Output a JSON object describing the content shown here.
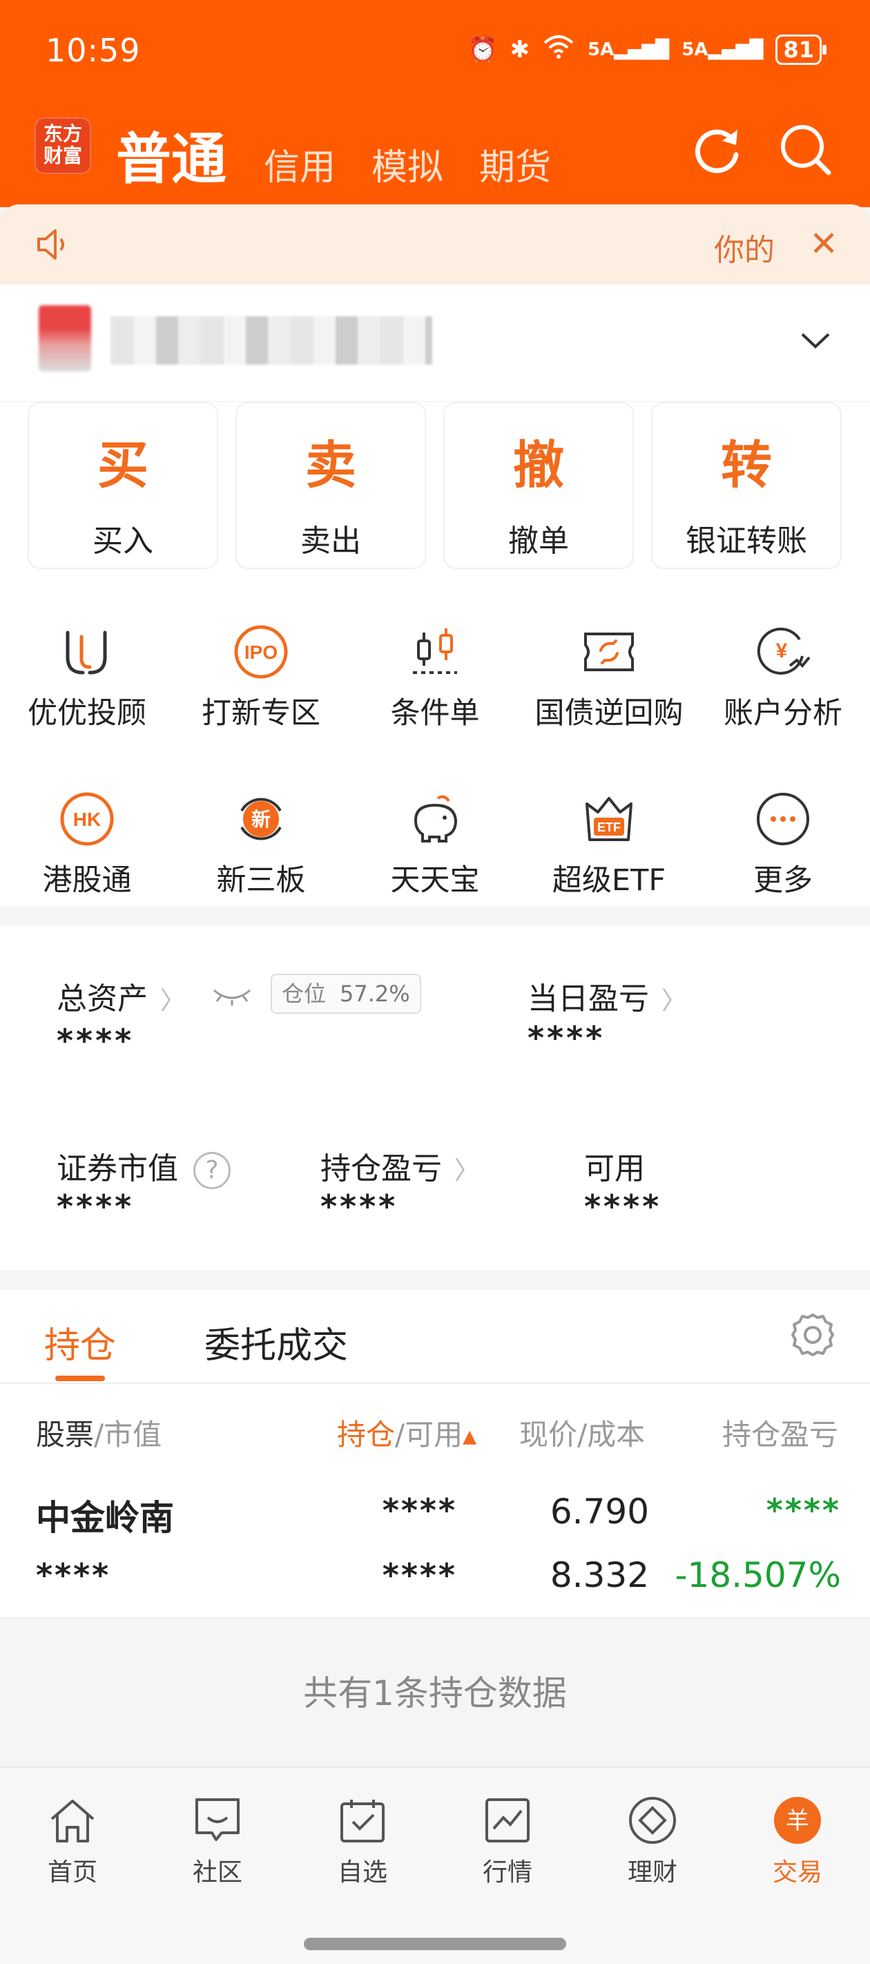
{
  "status_bar": {
    "time": "10:59",
    "battery": "81",
    "net1": "5A",
    "net2": "5A"
  },
  "header": {
    "logo_line1": "东方",
    "logo_line2": "财富",
    "tabs": [
      {
        "label": "普通",
        "active": true
      },
      {
        "label": "信用",
        "active": false
      },
      {
        "label": "模拟",
        "active": false
      },
      {
        "label": "期货",
        "active": false
      }
    ]
  },
  "notice": {
    "text": "你的"
  },
  "actions": [
    {
      "glyph": "买",
      "label": "买入"
    },
    {
      "glyph": "卖",
      "label": "卖出"
    },
    {
      "glyph": "撤",
      "label": "撤单"
    },
    {
      "glyph": "转",
      "label": "银证转账"
    }
  ],
  "grid": [
    {
      "icon": "youyou-icon",
      "label": "优优投顾"
    },
    {
      "icon": "ipo-icon",
      "label": "打新专区",
      "badge": "IPO"
    },
    {
      "icon": "candlestick-icon",
      "label": "条件单"
    },
    {
      "icon": "ticket-icon",
      "label": "国债逆回购"
    },
    {
      "icon": "yuan-chart-icon",
      "label": "账户分析",
      "badge": "¥"
    },
    {
      "icon": "hk-icon",
      "label": "港股通",
      "badge": "HK"
    },
    {
      "icon": "new-board-icon",
      "label": "新三板",
      "badge": "新"
    },
    {
      "icon": "piggy-bank-icon",
      "label": "天天宝"
    },
    {
      "icon": "etf-crown-icon",
      "label": "超级ETF",
      "badge": "ETF"
    },
    {
      "icon": "more-icon",
      "label": "更多"
    }
  ],
  "assets": {
    "total_label": "总资产",
    "total_value": "****",
    "position_label": "仓位",
    "position_value": "57.2%",
    "daily_pl_label": "当日盈亏",
    "daily_pl_value": "****",
    "securities_label": "证券市值",
    "securities_value": "****",
    "holding_pl_label": "持仓盈亏",
    "holding_pl_value": "****",
    "available_label": "可用",
    "available_value": "****"
  },
  "holdings": {
    "tabs": [
      "持仓",
      "委托成交"
    ],
    "columns": {
      "stock": "股票",
      "stock_sub": "/市值",
      "position": "持仓",
      "position_sub": "/可用",
      "price": "现价/成本",
      "pl": "持仓盈亏"
    },
    "rows": [
      {
        "name": "中金岭南",
        "market_value": "****",
        "position": "****",
        "available": "****",
        "price": "6.790",
        "cost": "8.332",
        "pl": "****",
        "pl_pct": "-18.507%"
      }
    ],
    "summary": "共有1条持仓数据"
  },
  "nav": [
    {
      "icon": "home-icon",
      "label": "首页"
    },
    {
      "icon": "community-icon",
      "label": "社区"
    },
    {
      "icon": "watchlist-icon",
      "label": "自选"
    },
    {
      "icon": "market-icon",
      "label": "行情"
    },
    {
      "icon": "wealth-icon",
      "label": "理财"
    },
    {
      "icon": "trade-icon",
      "label": "交易",
      "active": true,
      "badge": "羊"
    }
  ]
}
